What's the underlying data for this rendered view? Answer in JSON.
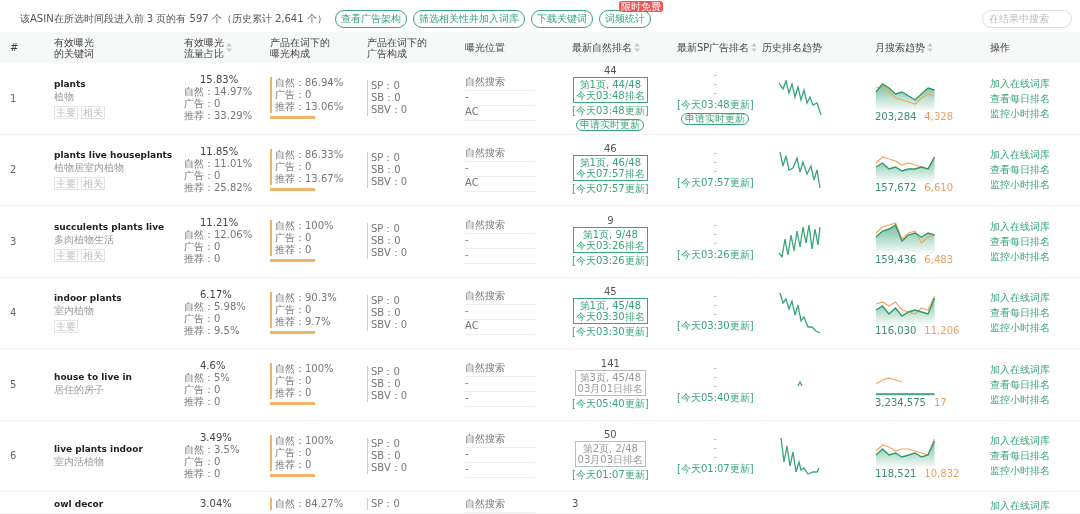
{
  "summary": "该ASIN在所选时间段进入前 3 页的有 597 个（历史累计 2,641 个）",
  "toolbar_buttons": [
    {
      "label": "查看广告架构"
    },
    {
      "label": "筛选相关性并加入词库"
    },
    {
      "label": "下载关键词"
    },
    {
      "label": "词频统计",
      "badge": "限时免费"
    }
  ],
  "search": {
    "placeholder": "在结果中搜索"
  },
  "columns": [
    {
      "lines": [
        "#"
      ],
      "sortable": false
    },
    {
      "lines": [
        "有效曝光",
        "的关键词"
      ],
      "sortable": false
    },
    {
      "lines": [
        "有效曝光",
        "流量占比"
      ],
      "sortable": true
    },
    {
      "lines": [
        "产品在词下的",
        "曝光构成"
      ],
      "sortable": false
    },
    {
      "lines": [
        "产品在词下的",
        "广告构成"
      ],
      "sortable": false
    },
    {
      "lines": [
        "曝光位置"
      ],
      "sortable": false
    },
    {
      "lines": [
        "最新自然排名"
      ],
      "sortable": true
    },
    {
      "lines": [
        "最新SP广告排名"
      ],
      "sortable": true
    },
    {
      "lines": [
        "历史排名趋势"
      ],
      "sortable": false
    },
    {
      "lines": [
        "月搜索趋势"
      ],
      "sortable": true
    },
    {
      "lines": [
        "操作"
      ],
      "sortable": false
    }
  ],
  "rows": [
    {
      "index": "1",
      "keyword": "plants",
      "translation": "植物",
      "tags": [
        "主要",
        "相关"
      ],
      "share": "15.83%",
      "share_lines": [
        "自然：14.97%",
        "广告：0",
        "推荐：33.29%"
      ],
      "composition": [
        "自然：86.94%",
        "广告：0",
        "推荐：13.06%"
      ],
      "ads": [
        "SP：0",
        "SB：0",
        "SBV：0"
      ],
      "positions": [
        "自然搜索",
        "-",
        "AC"
      ],
      "rank": {
        "value": "44",
        "page": "第1页, 44/48",
        "time": "今天03:48排名",
        "updated": "[今天03:48更新]",
        "current": true,
        "refresh": "申请实时更新"
      },
      "sp_rank": {
        "dashes": [
          "-",
          "-",
          "-"
        ],
        "updated": "[今天03:48更新]",
        "refresh": "申请实时更新"
      },
      "monthly": {
        "volume": "203,284",
        "second": "4,328"
      },
      "actions": [
        "加入在线词库",
        "查看每日排名",
        "监控小时排名"
      ]
    },
    {
      "index": "2",
      "keyword": "plants live houseplants",
      "translation": "植物居室内植物",
      "tags": [
        "主要",
        "相关"
      ],
      "share": "11.85%",
      "share_lines": [
        "自然：11.01%",
        "广告：0",
        "推荐：25.82%"
      ],
      "composition": [
        "自然：86.33%",
        "广告：0",
        "推荐：13.67%"
      ],
      "ads": [
        "SP：0",
        "SB：0",
        "SBV：0"
      ],
      "positions": [
        "自然搜索",
        "-",
        "AC"
      ],
      "rank": {
        "value": "46",
        "page": "第1页, 46/48",
        "time": "今天07:57排名",
        "updated": "[今天07:57更新]",
        "current": true
      },
      "sp_rank": {
        "dashes": [
          "-",
          "-",
          "-"
        ],
        "updated": "[今天07:57更新]"
      },
      "monthly": {
        "volume": "157,672",
        "second": "6,610"
      },
      "actions": [
        "加入在线词库",
        "查看每日排名",
        "监控小时排名"
      ]
    },
    {
      "index": "3",
      "keyword": "succulents plants live",
      "translation": "多肉植物生活",
      "tags": [
        "主要",
        "相关"
      ],
      "share": "11.21%",
      "share_lines": [
        "自然：12.06%",
        "广告：0",
        "推荐：0"
      ],
      "composition": [
        "自然：100%",
        "广告：0",
        "推荐：0"
      ],
      "ads": [
        "SP：0",
        "SB：0",
        "SBV：0"
      ],
      "positions": [
        "自然搜索",
        "-",
        "-"
      ],
      "rank": {
        "value": "9",
        "page": "第1页, 9/48",
        "time": "今天03:26排名",
        "updated": "[今天03:26更新]",
        "current": true
      },
      "sp_rank": {
        "dashes": [
          "-",
          "-",
          "-"
        ],
        "updated": "[今天03:26更新]"
      },
      "monthly": {
        "volume": "159,436",
        "second": "6,483"
      },
      "actions": [
        "加入在线词库",
        "查看每日排名",
        "监控小时排名"
      ]
    },
    {
      "index": "4",
      "keyword": "indoor plants",
      "translation": "室内植物",
      "tags": [
        "主要"
      ],
      "share": "6.17%",
      "share_lines": [
        "自然：5.98%",
        "广告：0",
        "推荐：9.5%"
      ],
      "composition": [
        "自然：90.3%",
        "广告：0",
        "推荐：9.7%"
      ],
      "ads": [
        "SP：0",
        "SB：0",
        "SBV：0"
      ],
      "positions": [
        "自然搜索",
        "-",
        "AC"
      ],
      "rank": {
        "value": "45",
        "page": "第1页, 45/48",
        "time": "今天03:30排名",
        "updated": "[今天03:30更新]",
        "current": true
      },
      "sp_rank": {
        "dashes": [
          "-",
          "-",
          "-"
        ],
        "updated": "[今天03:30更新]"
      },
      "monthly": {
        "volume": "116,030",
        "second": "11,206"
      },
      "actions": [
        "加入在线词库",
        "查看每日排名",
        "监控小时排名"
      ]
    },
    {
      "index": "5",
      "keyword": "house to live in",
      "translation": "居住的房子",
      "tags": [],
      "share": "4.6%",
      "share_lines": [
        "自然：5%",
        "广告：0",
        "推荐：0"
      ],
      "composition": [
        "自然：100%",
        "广告：0",
        "推荐：0"
      ],
      "ads": [
        "SP：0",
        "SB：0",
        "SBV：0"
      ],
      "positions": [
        "自然搜索",
        "-",
        "-"
      ],
      "rank": {
        "value": "141",
        "page": "第3页, 45/48",
        "time": "03月01日排名",
        "updated": "[今天05:40更新]",
        "current": false
      },
      "sp_rank": {
        "dashes": [
          "-",
          "-",
          "-"
        ],
        "updated": "[今天05:40更新]"
      },
      "monthly": {
        "volume": "3,234,575",
        "second": "17"
      },
      "actions": [
        "加入在线词库",
        "查看每日排名",
        "监控小时排名"
      ]
    },
    {
      "index": "6",
      "keyword": "live plants indoor",
      "translation": "室内活植物",
      "tags": [],
      "share": "3.49%",
      "share_lines": [
        "自然：3.5%",
        "广告：0",
        "推荐：0"
      ],
      "composition": [
        "自然：100%",
        "广告：0",
        "推荐：0"
      ],
      "ads": [
        "SP：0",
        "SB：0",
        "SBV：0"
      ],
      "positions": [
        "自然搜索",
        "-",
        "-"
      ],
      "rank": {
        "value": "50",
        "page": "第2页, 2/48",
        "time": "03月03日排名",
        "updated": "[今天01:07更新]",
        "current": false
      },
      "sp_rank": {
        "dashes": [
          "-",
          "-",
          "-"
        ],
        "updated": "[今天01:07更新]"
      },
      "monthly": {
        "volume": "118,521",
        "second": "10,832"
      },
      "actions": [
        "加入在线词库",
        "查看每日排名",
        "监控小时排名"
      ]
    },
    {
      "keyword": "owl decor",
      "share": "3.04%",
      "composition": [
        "自然：84.27%"
      ],
      "ads": [
        "SP：0"
      ],
      "positions": [
        "自然搜索"
      ],
      "rank": {
        "value": "3"
      },
      "actions": [
        "加入在线词库"
      ]
    }
  ]
}
